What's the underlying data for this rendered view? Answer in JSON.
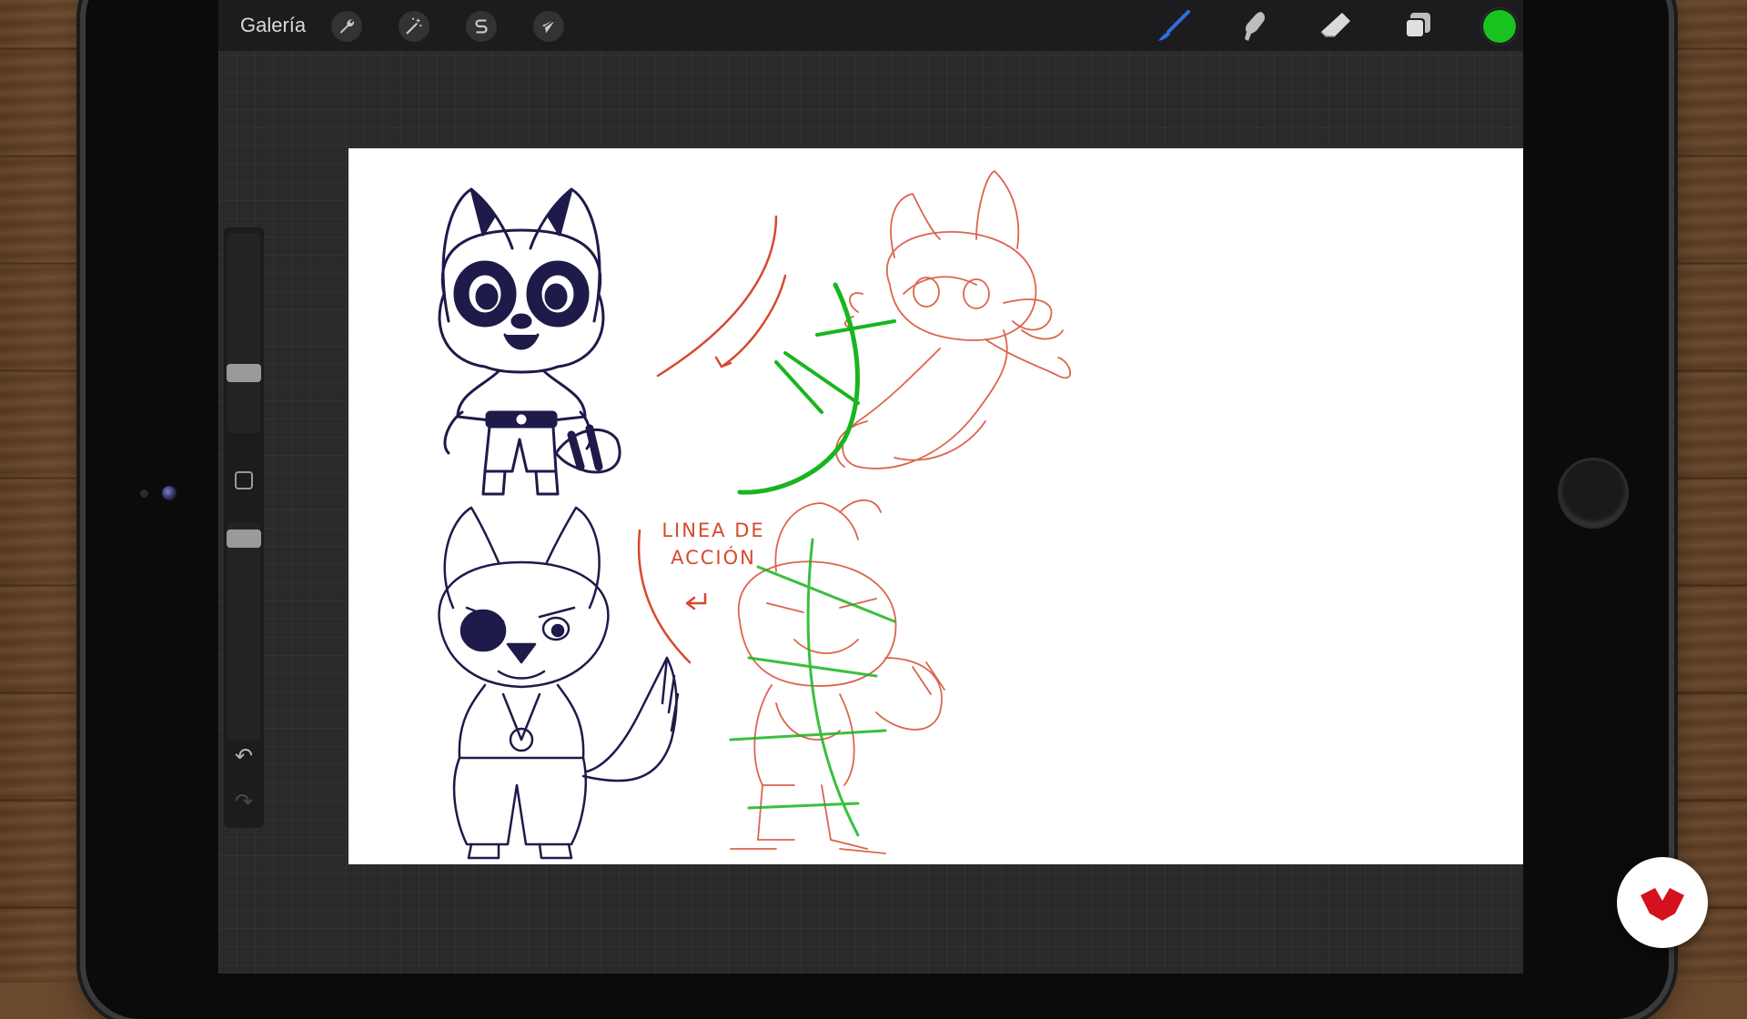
{
  "app": {
    "gallery_label": "Galería"
  },
  "toolbar": {
    "left_tools": [
      {
        "name": "actions",
        "icon": "wrench-icon"
      },
      {
        "name": "adjustments",
        "icon": "magic-wand-icon"
      },
      {
        "name": "selection",
        "icon": "selection-s-icon"
      },
      {
        "name": "transform",
        "icon": "arrow-cursor-icon"
      }
    ],
    "right_tools": [
      {
        "name": "brush",
        "icon": "brush-icon",
        "active": true
      },
      {
        "name": "smudge",
        "icon": "smudge-icon"
      },
      {
        "name": "eraser",
        "icon": "eraser-icon"
      },
      {
        "name": "layers",
        "icon": "layers-icon"
      }
    ],
    "current_color": "#19c21f",
    "accent_color": "#2f6fe0"
  },
  "sidebar": {
    "brush_size_label": "brush size",
    "opacity_label": "opacity",
    "modify_button": "square-icon",
    "undo_icon": "undo-icon",
    "redo_icon": "redo-icon"
  },
  "canvas": {
    "caption_line1": "LINEA DE",
    "caption_line2": "ACCIÓN",
    "ink_color": "#1e1a4a",
    "sketch_color": "#d6492f",
    "action_line_color": "#19b51f"
  },
  "logo": {
    "icon": "brand-logo-icon",
    "color": "#d4111e"
  }
}
